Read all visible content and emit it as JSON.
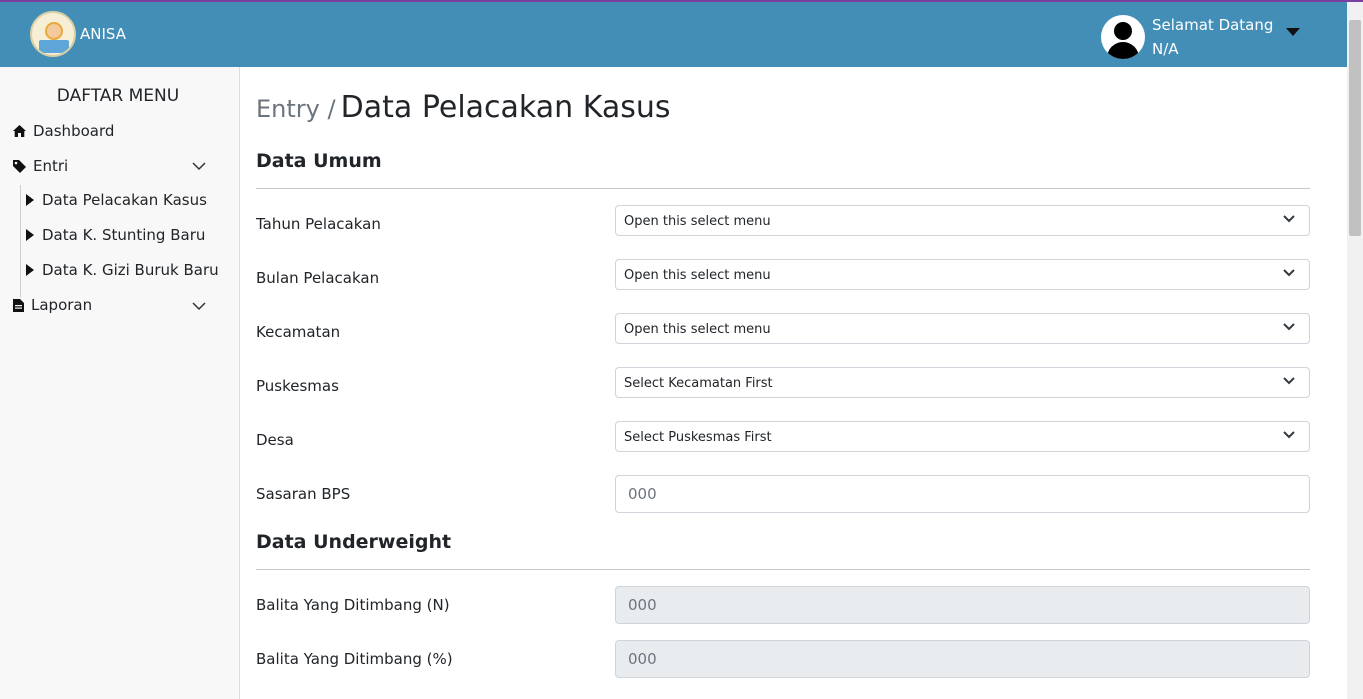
{
  "header": {
    "brand": "ANISA",
    "greeting": "Selamat Datang",
    "user": "N/A"
  },
  "sidebar": {
    "title": "DAFTAR MENU",
    "dashboard": "Dashboard",
    "entri": "Entri",
    "entri_items": [
      "Data Pelacakan Kasus",
      "Data K. Stunting Baru",
      "Data K. Gizi Buruk Baru"
    ],
    "laporan": "Laporan"
  },
  "page": {
    "breadcrumb": "Entry /",
    "title": "Data Pelacakan Kasus"
  },
  "sections": {
    "umum": "Data Umum",
    "underweight": "Data Underweight"
  },
  "form": {
    "tahun": {
      "label": "Tahun Pelacakan",
      "value": "Open this select menu"
    },
    "bulan": {
      "label": "Bulan Pelacakan",
      "value": "Open this select menu"
    },
    "kecamatan": {
      "label": "Kecamatan",
      "value": "Open this select menu"
    },
    "puskesmas": {
      "label": "Puskesmas",
      "value": "Select Kecamatan First"
    },
    "desa": {
      "label": "Desa",
      "value": "Select Puskesmas First"
    },
    "sasaran": {
      "label": "Sasaran BPS",
      "placeholder": "000"
    },
    "ditimbang_n": {
      "label": "Balita Yang Ditimbang (N)",
      "placeholder": "000"
    },
    "ditimbang_pct": {
      "label": "Balita Yang Ditimbang (%)",
      "placeholder": "000"
    }
  },
  "colors": {
    "navbar": "#428eb6",
    "sidebar": "#f8f8f8"
  }
}
